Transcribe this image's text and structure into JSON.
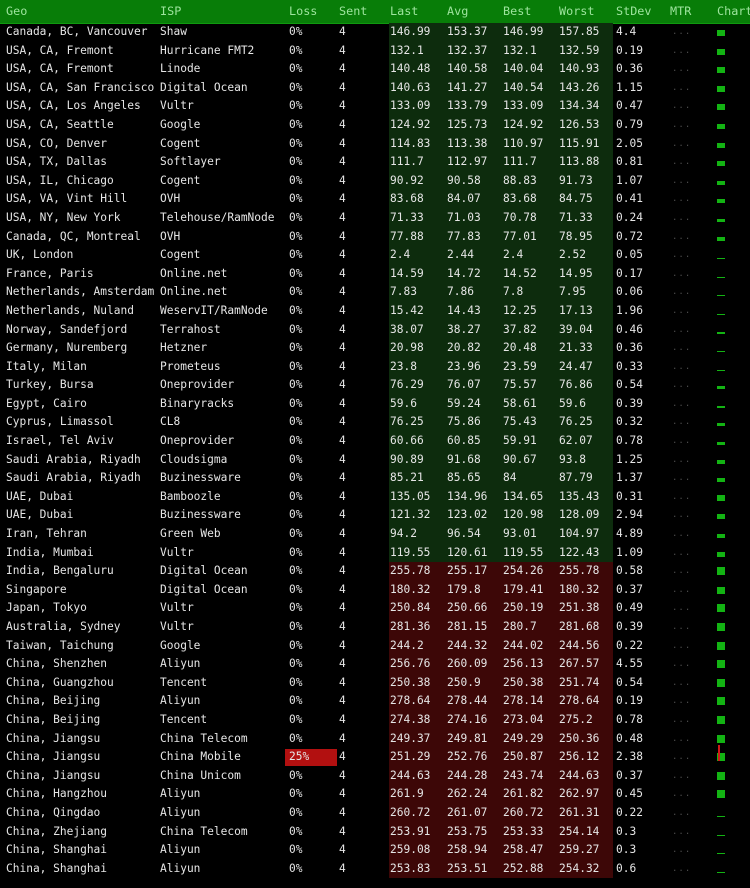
{
  "header": {
    "labels": [
      "Geo",
      "ISP",
      "Loss",
      "Sent",
      "Last",
      "Avg",
      "Best",
      "Worst",
      "StDev",
      "MTR",
      "Chart"
    ]
  },
  "colors": {
    "header_bg": "#087d08",
    "fast_band": "#0d2c0d",
    "slow_band": "#3d0707",
    "loss_alert": "#b21010",
    "spark": "#13b313"
  },
  "rows": [
    {
      "geo": "Canada, BC, Vancouver",
      "isp": "Shaw",
      "loss": "0%",
      "sent": "4",
      "last": "146.99",
      "avg": "153.37",
      "best": "146.99",
      "worst": "157.85",
      "stdev": "4.4",
      "mtr": "...",
      "status": "fast",
      "chart_level": 0.8
    },
    {
      "geo": "USA, CA, Fremont",
      "isp": "Hurricane FMT2",
      "loss": "0%",
      "sent": "4",
      "last": "132.1",
      "avg": "132.37",
      "best": "132.1",
      "worst": "132.59",
      "stdev": "0.19",
      "mtr": "...",
      "status": "fast",
      "chart_level": 0.7
    },
    {
      "geo": "USA, CA, Fremont",
      "isp": "Linode",
      "loss": "0%",
      "sent": "4",
      "last": "140.48",
      "avg": "140.58",
      "best": "140.04",
      "worst": "140.93",
      "stdev": "0.36",
      "mtr": "...",
      "status": "fast",
      "chart_level": 0.7
    },
    {
      "geo": "USA, CA, San Francisco",
      "isp": "Digital Ocean",
      "loss": "0%",
      "sent": "4",
      "last": "140.63",
      "avg": "141.27",
      "best": "140.54",
      "worst": "143.26",
      "stdev": "1.15",
      "mtr": "...",
      "status": "fast",
      "chart_level": 0.7
    },
    {
      "geo": "USA, CA, Los Angeles",
      "isp": "Vultr",
      "loss": "0%",
      "sent": "4",
      "last": "133.09",
      "avg": "133.79",
      "best": "133.09",
      "worst": "134.34",
      "stdev": "0.47",
      "mtr": "...",
      "status": "fast",
      "chart_level": 0.7
    },
    {
      "geo": "USA, CA, Seattle",
      "isp": "Google",
      "loss": "0%",
      "sent": "4",
      "last": "124.92",
      "avg": "125.73",
      "best": "124.92",
      "worst": "126.53",
      "stdev": "0.79",
      "mtr": "...",
      "status": "fast",
      "chart_level": 0.65
    },
    {
      "geo": "USA, CO, Denver",
      "isp": "Cogent",
      "loss": "0%",
      "sent": "4",
      "last": "114.83",
      "avg": "113.38",
      "best": "110.97",
      "worst": "115.91",
      "stdev": "2.05",
      "mtr": "...",
      "status": "fast",
      "chart_level": 0.6
    },
    {
      "geo": "USA, TX, Dallas",
      "isp": "Softlayer",
      "loss": "0%",
      "sent": "4",
      "last": "111.7",
      "avg": "112.97",
      "best": "111.7",
      "worst": "113.88",
      "stdev": "0.81",
      "mtr": "...",
      "status": "fast",
      "chart_level": 0.6
    },
    {
      "geo": "USA, IL, Chicago",
      "isp": "Cogent",
      "loss": "0%",
      "sent": "4",
      "last": "90.92",
      "avg": "90.58",
      "best": "88.83",
      "worst": "91.73",
      "stdev": "1.07",
      "mtr": "...",
      "status": "fast",
      "chart_level": 0.5
    },
    {
      "geo": "USA, VA, Vint Hill",
      "isp": "OVH",
      "loss": "0%",
      "sent": "4",
      "last": "83.68",
      "avg": "84.07",
      "best": "83.68",
      "worst": "84.75",
      "stdev": "0.41",
      "mtr": "...",
      "status": "fast",
      "chart_level": 0.45
    },
    {
      "geo": "USA, NY, New York",
      "isp": "Telehouse/RamNode",
      "loss": "0%",
      "sent": "4",
      "last": "71.33",
      "avg": "71.03",
      "best": "70.78",
      "worst": "71.33",
      "stdev": "0.24",
      "mtr": "...",
      "status": "fast",
      "chart_level": 0.4
    },
    {
      "geo": "Canada, QC, Montreal",
      "isp": "OVH",
      "loss": "0%",
      "sent": "4",
      "last": "77.88",
      "avg": "77.83",
      "best": "77.01",
      "worst": "78.95",
      "stdev": "0.72",
      "mtr": "...",
      "status": "fast",
      "chart_level": 0.45
    },
    {
      "geo": "UK, London",
      "isp": "Cogent",
      "loss": "0%",
      "sent": "4",
      "last": "2.4",
      "avg": "2.44",
      "best": "2.4",
      "worst": "2.52",
      "stdev": "0.05",
      "mtr": "...",
      "status": "fast",
      "chart_level": 0.05
    },
    {
      "geo": "France, Paris",
      "isp": "Online.net",
      "loss": "0%",
      "sent": "4",
      "last": "14.59",
      "avg": "14.72",
      "best": "14.52",
      "worst": "14.95",
      "stdev": "0.17",
      "mtr": "...",
      "status": "fast",
      "chart_level": 0.1
    },
    {
      "geo": "Netherlands, Amsterdam",
      "isp": "Online.net",
      "loss": "0%",
      "sent": "4",
      "last": "7.83",
      "avg": "7.86",
      "best": "7.8",
      "worst": "7.95",
      "stdev": "0.06",
      "mtr": "...",
      "status": "fast",
      "chart_level": 0.06
    },
    {
      "geo": "Netherlands, Nuland",
      "isp": "WeservIT/RamNode",
      "loss": "0%",
      "sent": "4",
      "last": "15.42",
      "avg": "14.43",
      "best": "12.25",
      "worst": "17.13",
      "stdev": "1.96",
      "mtr": "...",
      "status": "fast",
      "chart_level": 0.1
    },
    {
      "geo": "Norway, Sandefjord",
      "isp": "Terrahost",
      "loss": "0%",
      "sent": "4",
      "last": "38.07",
      "avg": "38.27",
      "best": "37.82",
      "worst": "39.04",
      "stdev": "0.46",
      "mtr": "...",
      "status": "fast",
      "chart_level": 0.2
    },
    {
      "geo": "Germany, Nuremberg",
      "isp": "Hetzner",
      "loss": "0%",
      "sent": "4",
      "last": "20.98",
      "avg": "20.82",
      "best": "20.48",
      "worst": "21.33",
      "stdev": "0.36",
      "mtr": "...",
      "status": "fast",
      "chart_level": 0.12
    },
    {
      "geo": "Italy, Milan",
      "isp": "Prometeus",
      "loss": "0%",
      "sent": "4",
      "last": "23.8",
      "avg": "23.96",
      "best": "23.59",
      "worst": "24.47",
      "stdev": "0.33",
      "mtr": "...",
      "status": "fast",
      "chart_level": 0.13
    },
    {
      "geo": "Turkey, Bursa",
      "isp": "Oneprovider",
      "loss": "0%",
      "sent": "4",
      "last": "76.29",
      "avg": "76.07",
      "best": "75.57",
      "worst": "76.86",
      "stdev": "0.54",
      "mtr": "...",
      "status": "fast",
      "chart_level": 0.4
    },
    {
      "geo": "Egypt, Cairo",
      "isp": "Binaryracks",
      "loss": "0%",
      "sent": "4",
      "last": "59.6",
      "avg": "59.24",
      "best": "58.61",
      "worst": "59.6",
      "stdev": "0.39",
      "mtr": "...",
      "status": "fast",
      "chart_level": 0.3
    },
    {
      "geo": "Cyprus, Limassol",
      "isp": "CL8",
      "loss": "0%",
      "sent": "4",
      "last": "76.25",
      "avg": "75.86",
      "best": "75.43",
      "worst": "76.25",
      "stdev": "0.32",
      "mtr": "...",
      "status": "fast",
      "chart_level": 0.4
    },
    {
      "geo": "Israel, Tel Aviv",
      "isp": "Oneprovider",
      "loss": "0%",
      "sent": "4",
      "last": "60.66",
      "avg": "60.85",
      "best": "59.91",
      "worst": "62.07",
      "stdev": "0.78",
      "mtr": "...",
      "status": "fast",
      "chart_level": 0.35
    },
    {
      "geo": "Saudi Arabia, Riyadh",
      "isp": "Cloudsigma",
      "loss": "0%",
      "sent": "4",
      "last": "90.89",
      "avg": "91.68",
      "best": "90.67",
      "worst": "93.8",
      "stdev": "1.25",
      "mtr": "...",
      "status": "fast",
      "chart_level": 0.5
    },
    {
      "geo": "Saudi Arabia, Riyadh",
      "isp": "Buzinessware",
      "loss": "0%",
      "sent": "4",
      "last": "85.21",
      "avg": "85.65",
      "best": "84",
      "worst": "87.79",
      "stdev": "1.37",
      "mtr": "...",
      "status": "fast",
      "chart_level": 0.45
    },
    {
      "geo": "UAE, Dubai",
      "isp": "Bamboozle",
      "loss": "0%",
      "sent": "4",
      "last": "135.05",
      "avg": "134.96",
      "best": "134.65",
      "worst": "135.43",
      "stdev": "0.31",
      "mtr": "...",
      "status": "fast",
      "chart_level": 0.7
    },
    {
      "geo": "UAE, Dubai",
      "isp": "Buzinessware",
      "loss": "0%",
      "sent": "4",
      "last": "121.32",
      "avg": "123.02",
      "best": "120.98",
      "worst": "128.09",
      "stdev": "2.94",
      "mtr": "...",
      "status": "fast",
      "chart_level": 0.65
    },
    {
      "geo": "Iran, Tehran",
      "isp": "Green Web",
      "loss": "0%",
      "sent": "4",
      "last": "94.2",
      "avg": "96.54",
      "best": "93.01",
      "worst": "104.97",
      "stdev": "4.89",
      "mtr": "...",
      "status": "fast",
      "chart_level": 0.55
    },
    {
      "geo": "India, Mumbai",
      "isp": "Vultr",
      "loss": "0%",
      "sent": "4",
      "last": "119.55",
      "avg": "120.61",
      "best": "119.55",
      "worst": "122.43",
      "stdev": "1.09",
      "mtr": "...",
      "status": "fast",
      "chart_level": 0.65
    },
    {
      "geo": "India, Bengaluru",
      "isp": "Digital Ocean",
      "loss": "0%",
      "sent": "4",
      "last": "255.78",
      "avg": "255.17",
      "best": "254.26",
      "worst": "255.78",
      "stdev": "0.58",
      "mtr": "...",
      "status": "slow",
      "chart_level": 1.0
    },
    {
      "geo": "Singapore",
      "isp": "Digital Ocean",
      "loss": "0%",
      "sent": "4",
      "last": "180.32",
      "avg": "179.8",
      "best": "179.41",
      "worst": "180.32",
      "stdev": "0.37",
      "mtr": "...",
      "status": "slow",
      "chart_level": 0.9
    },
    {
      "geo": "Japan, Tokyo",
      "isp": "Vultr",
      "loss": "0%",
      "sent": "4",
      "last": "250.84",
      "avg": "250.66",
      "best": "250.19",
      "worst": "251.38",
      "stdev": "0.49",
      "mtr": "...",
      "status": "slow",
      "chart_level": 1.0
    },
    {
      "geo": "Australia, Sydney",
      "isp": "Vultr",
      "loss": "0%",
      "sent": "4",
      "last": "281.36",
      "avg": "281.15",
      "best": "280.7",
      "worst": "281.68",
      "stdev": "0.39",
      "mtr": "...",
      "status": "slow",
      "chart_level": 1.0
    },
    {
      "geo": "Taiwan, Taichung",
      "isp": "Google",
      "loss": "0%",
      "sent": "4",
      "last": "244.2",
      "avg": "244.32",
      "best": "244.02",
      "worst": "244.56",
      "stdev": "0.22",
      "mtr": "...",
      "status": "slow",
      "chart_level": 1.0
    },
    {
      "geo": "China, Shenzhen",
      "isp": "Aliyun",
      "loss": "0%",
      "sent": "4",
      "last": "256.76",
      "avg": "260.09",
      "best": "256.13",
      "worst": "267.57",
      "stdev": "4.55",
      "mtr": "...",
      "status": "slow",
      "chart_level": 1.0
    },
    {
      "geo": "China, Guangzhou",
      "isp": "Tencent",
      "loss": "0%",
      "sent": "4",
      "last": "250.38",
      "avg": "250.9",
      "best": "250.38",
      "worst": "251.74",
      "stdev": "0.54",
      "mtr": "...",
      "status": "slow",
      "chart_level": 1.0
    },
    {
      "geo": "China, Beijing",
      "isp": "Aliyun",
      "loss": "0%",
      "sent": "4",
      "last": "278.64",
      "avg": "278.44",
      "best": "278.14",
      "worst": "278.64",
      "stdev": "0.19",
      "mtr": "...",
      "status": "slow",
      "chart_level": 1.0
    },
    {
      "geo": "China, Beijing",
      "isp": "Tencent",
      "loss": "0%",
      "sent": "4",
      "last": "274.38",
      "avg": "274.16",
      "best": "273.04",
      "worst": "275.2",
      "stdev": "0.78",
      "mtr": "...",
      "status": "slow",
      "chart_level": 1.0
    },
    {
      "geo": "China, Jiangsu",
      "isp": "China Telecom",
      "loss": "0%",
      "sent": "4",
      "last": "249.37",
      "avg": "249.81",
      "best": "249.29",
      "worst": "250.36",
      "stdev": "0.48",
      "mtr": "...",
      "status": "slow",
      "chart_level": 1.0
    },
    {
      "geo": "China, Jiangsu",
      "isp": "China Mobile",
      "loss": "25%",
      "sent": "4",
      "last": "251.29",
      "avg": "252.76",
      "best": "250.87",
      "worst": "256.12",
      "stdev": "2.38",
      "mtr": "...",
      "status": "slow",
      "chart_level": 1.0,
      "loss_alert": true
    },
    {
      "geo": "China, Jiangsu",
      "isp": "China Unicom",
      "loss": "0%",
      "sent": "4",
      "last": "244.63",
      "avg": "244.28",
      "best": "243.74",
      "worst": "244.63",
      "stdev": "0.37",
      "mtr": "...",
      "status": "slow",
      "chart_level": 1.0
    },
    {
      "geo": "China, Hangzhou",
      "isp": "Aliyun",
      "loss": "0%",
      "sent": "4",
      "last": "261.9",
      "avg": "262.24",
      "best": "261.82",
      "worst": "262.97",
      "stdev": "0.45",
      "mtr": "...",
      "status": "slow",
      "chart_level": 1.0
    },
    {
      "geo": "China, Qingdao",
      "isp": "Aliyun",
      "loss": "0%",
      "sent": "4",
      "last": "260.72",
      "avg": "261.07",
      "best": "260.72",
      "worst": "261.31",
      "stdev": "0.22",
      "mtr": "...",
      "status": "slow",
      "chart_level": 0.1
    },
    {
      "geo": "China, Zhejiang",
      "isp": "China Telecom",
      "loss": "0%",
      "sent": "4",
      "last": "253.91",
      "avg": "253.75",
      "best": "253.33",
      "worst": "254.14",
      "stdev": "0.3",
      "mtr": "...",
      "status": "slow",
      "chart_level": 0.0
    },
    {
      "geo": "China, Shanghai",
      "isp": "Aliyun",
      "loss": "0%",
      "sent": "4",
      "last": "259.08",
      "avg": "258.94",
      "best": "258.47",
      "worst": "259.27",
      "stdev": "0.3",
      "mtr": "...",
      "status": "slow",
      "chart_level": 0.0
    },
    {
      "geo": "China, Shanghai",
      "isp": "Aliyun",
      "loss": "0%",
      "sent": "4",
      "last": "253.83",
      "avg": "253.51",
      "best": "252.88",
      "worst": "254.32",
      "stdev": "0.6",
      "mtr": "...",
      "status": "slow",
      "chart_level": 0.0
    }
  ]
}
